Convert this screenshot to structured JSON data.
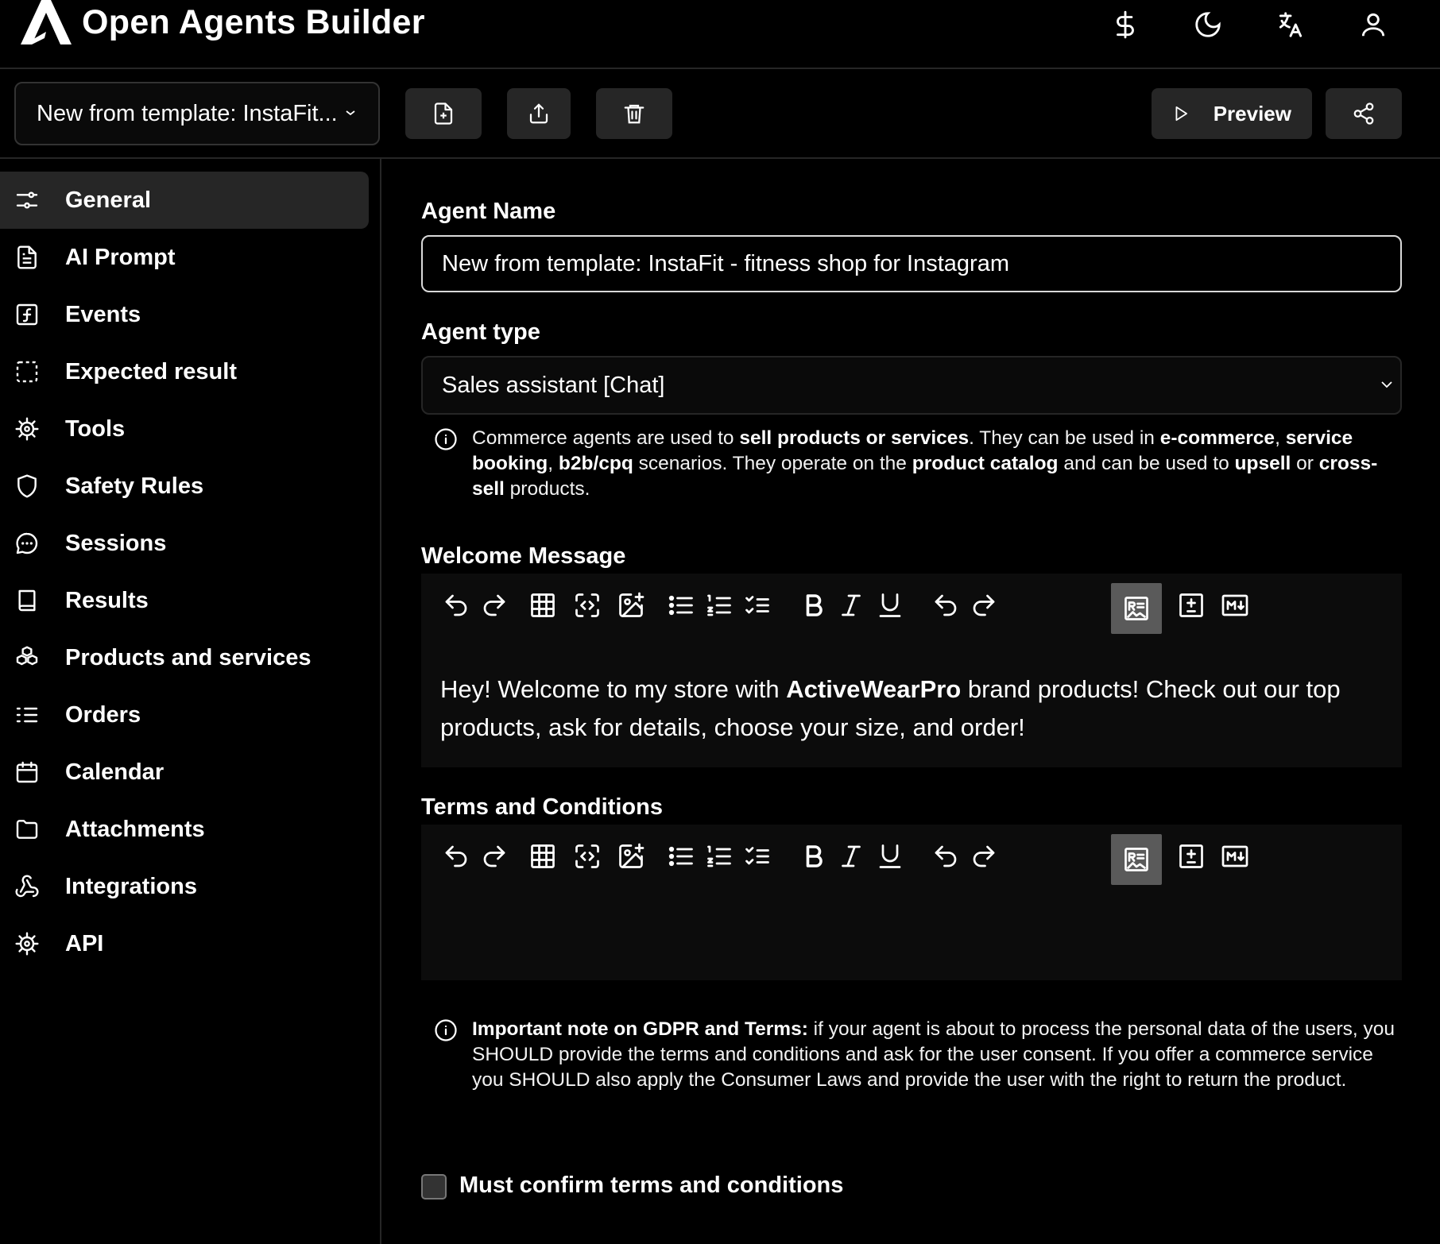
{
  "app": {
    "title": "Open Agents Builder"
  },
  "header": {
    "icons": [
      "dollar-icon",
      "moon-icon",
      "translate-icon",
      "user-icon"
    ]
  },
  "toolbar": {
    "template_select": "New from template: InstaFit...",
    "preview_label": "Preview"
  },
  "sidebar": {
    "items": [
      {
        "label": "General",
        "icon": "sliders-icon",
        "active": true
      },
      {
        "label": "AI Prompt",
        "icon": "document-icon"
      },
      {
        "label": "Events",
        "icon": "function-icon"
      },
      {
        "label": "Expected result",
        "icon": "dashed-square-icon"
      },
      {
        "label": "Tools",
        "icon": "cog-icon"
      },
      {
        "label": "Safety Rules",
        "icon": "shield-icon"
      },
      {
        "label": "Sessions",
        "icon": "chat-icon"
      },
      {
        "label": "Results",
        "icon": "book-icon"
      },
      {
        "label": "Products and services",
        "icon": "boxes-icon"
      },
      {
        "label": "Orders",
        "icon": "list-ordered-icon"
      },
      {
        "label": "Calendar",
        "icon": "calendar-icon"
      },
      {
        "label": "Attachments",
        "icon": "folder-icon"
      },
      {
        "label": "Integrations",
        "icon": "webhook-icon"
      },
      {
        "label": "API",
        "icon": "cog-icon"
      }
    ]
  },
  "form": {
    "agent_name_label": "Agent Name",
    "agent_name_value": "New from template: InstaFit - fitness shop for Instagram",
    "agent_type_label": "Agent type",
    "agent_type_value": "Sales assistant [Chat]",
    "agent_type_info": {
      "t1": "Commerce agents are used to ",
      "b1": "sell products or services",
      "t2": ". They can be used in ",
      "b2": "e-commerce",
      "t3": ", ",
      "b3": "service booking",
      "t4": ", ",
      "b4": "b2b/cpq",
      "t5": " scenarios. They operate on the ",
      "b5": "product catalog",
      "t6": " and can be used to ",
      "b6": "upsell",
      "t7": " or ",
      "b7": "cross-sell",
      "t8": " products."
    },
    "welcome_label": "Welcome Message",
    "welcome": {
      "t1": "Hey! Welcome to my store with ",
      "b1": "ActiveWearPro",
      "t2": " brand products! Check out our top products, ask for details, choose your size, and order!"
    },
    "terms_label": "Terms and Conditions",
    "gdpr_note": {
      "b1": "Important note on GDPR and Terms:",
      "t1": " if your agent is about to process the personal data of the users, you SHOULD provide the terms and conditions and ask for the user consent. If you offer a commerce service you SHOULD also apply the Consumer Laws and provide the user with the right to return the product."
    },
    "confirm_label": "Must confirm terms and conditions"
  },
  "editor_toolbar": [
    "undo-icon",
    "redo-icon",
    "table-icon",
    "code-block-icon",
    "insert-image-icon",
    "bullet-list-icon",
    "numbered-list-icon",
    "check-list-icon",
    "bold-icon",
    "italic-icon",
    "underline-icon",
    "undo-icon",
    "redo-icon",
    "rich-text-icon",
    "diff-icon",
    "markdown-icon"
  ]
}
